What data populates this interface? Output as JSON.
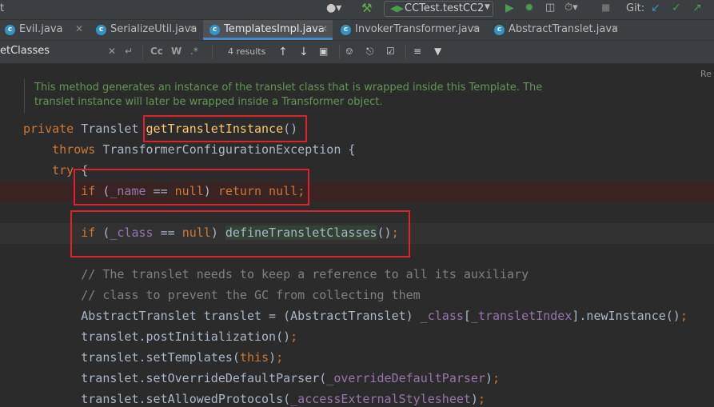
{
  "toolbar": {
    "left_fragment": "t",
    "run_config": "CCTest.testCC2",
    "vcs_label": "Git:"
  },
  "tabs": [
    {
      "label": "Evil.java"
    },
    {
      "label": "SerializeUtil.java"
    },
    {
      "label": "TemplatesImpl.java",
      "active": true
    },
    {
      "label": "InvokerTransformer.java"
    },
    {
      "label": "AbstractTranslet.java"
    }
  ],
  "search": {
    "query": "etClasses",
    "case_label": "Cc",
    "word_label": "W",
    "results": "4 results"
  },
  "editor": {
    "right_marker": "Re",
    "javadoc": [
      "This method generates an instance of the translet class that is wrapped inside this Template. The",
      "translet instance will later be wrapped inside a Transformer object."
    ],
    "lines": {
      "l1_a": "private",
      "l1_b": " Translet ",
      "l1_c": "getTransletInstance",
      "l1_d": "()",
      "l2_a": "    throws",
      "l2_b": " TransformerConfigurationException {",
      "l3_a": "    try",
      "l3_b": " {",
      "l4_a": "        if",
      "l4_b": " (",
      "l4_c": "_name",
      "l4_d": " == ",
      "l4_e": "null",
      "l4_f": ") ",
      "l4_g": "return null",
      "l4_h": ";",
      "l5_a": "        if",
      "l5_b": " (",
      "l5_c": "_class",
      "l5_d": " == ",
      "l5_e": "null",
      "l5_f": ") ",
      "l5_g": "defineTransletClasses",
      "l5_h": "()",
      "l5_i": ";",
      "l6": "        // The translet needs to keep a reference to all its auxiliary",
      "l7": "        // class to prevent the GC from collecting them",
      "l8_a": "        AbstractTranslet translet = (AbstractTranslet) ",
      "l8_b": "_class",
      "l8_c": "[",
      "l8_d": "_transletIndex",
      "l8_e": "].newInstance()",
      "l8_f": ";",
      "l9_a": "        translet.postInitialization()",
      "l9_b": ";",
      "l10_a": "        translet.setTemplates(",
      "l10_b": "this",
      "l10_c": ")",
      "l10_d": ";",
      "l11_a": "        translet.setOverrideDefaultParser(",
      "l11_b": "_overrideDefaultParser",
      "l11_c": ")",
      "l11_d": ";",
      "l12_a": "        translet.setAllowedProtocols(",
      "l12_b": "_accessExternalStylesheet",
      "l12_c": ")",
      "l12_d": ";"
    }
  },
  "colors": {
    "background": "#2b2b2b",
    "keyword": "#cc7832",
    "method": "#ffc66d",
    "field": "#9876aa",
    "comment": "#808080",
    "doc": "#629755",
    "annotation_box": "#e0202a"
  }
}
